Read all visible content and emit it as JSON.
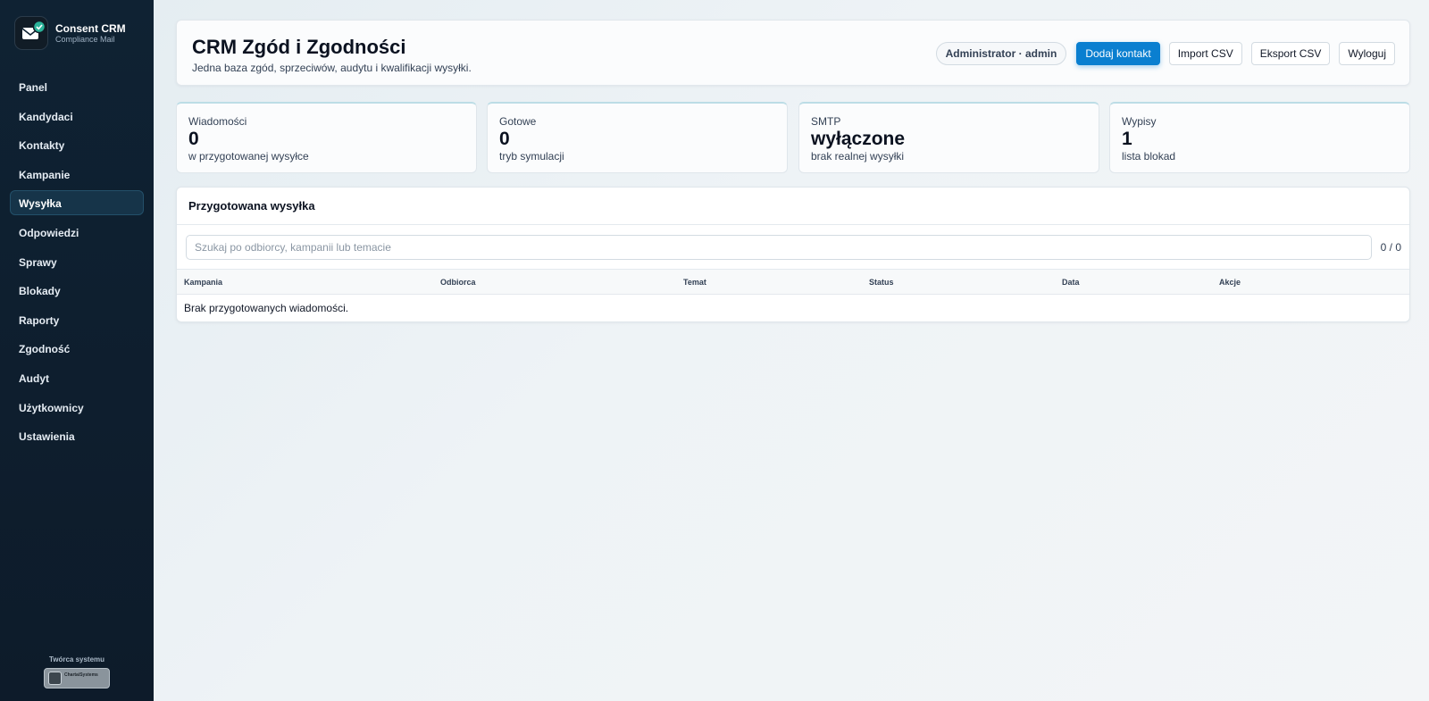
{
  "brand": {
    "name": "Consent CRM",
    "subtitle": "Compliance Mail"
  },
  "sidebar": {
    "items": [
      {
        "label": "Panel"
      },
      {
        "label": "Kandydaci"
      },
      {
        "label": "Kontakty"
      },
      {
        "label": "Kampanie"
      },
      {
        "label": "Wysyłka",
        "active": true
      },
      {
        "label": "Odpowiedzi"
      },
      {
        "label": "Sprawy"
      },
      {
        "label": "Blokady"
      },
      {
        "label": "Raporty"
      },
      {
        "label": "Zgodność"
      },
      {
        "label": "Audyt"
      },
      {
        "label": "Użytkownicy"
      },
      {
        "label": "Ustawienia"
      }
    ],
    "creator_label": "Twórca systemu",
    "creator_badge_text": "ChartaiSystems"
  },
  "header": {
    "title": "CRM Zgód i Zgodności",
    "subtitle": "Jedna baza zgód, sprzeciwów, audytu i kwalifikacji wysyłki.",
    "user": "Administrator · admin",
    "buttons": {
      "add_contact": "Dodaj kontakt",
      "import_csv": "Import CSV",
      "export_csv": "Eksport CSV",
      "logout": "Wyloguj"
    }
  },
  "stats": [
    {
      "label": "Wiadomości",
      "value": "0",
      "desc": "w przygotowanej wysyłce"
    },
    {
      "label": "Gotowe",
      "value": "0",
      "desc": "tryb symulacji"
    },
    {
      "label": "SMTP",
      "value": "wyłączone",
      "desc": "brak realnej wysyłki"
    },
    {
      "label": "Wypisy",
      "value": "1",
      "desc": "lista blokad"
    }
  ],
  "panel": {
    "title": "Przygotowana wysyłka",
    "search_placeholder": "Szukaj po odbiorcy, kampanii lub temacie",
    "count": "0 / 0",
    "columns": [
      "Kampania",
      "Odbiorca",
      "Temat",
      "Status",
      "Data",
      "Akcje"
    ],
    "empty_text": "Brak przygotowanych wiadomości."
  },
  "colors": {
    "sidebar_bg": "#0f2233",
    "accent": "#0a7fd0",
    "active_nav": "#163449"
  }
}
